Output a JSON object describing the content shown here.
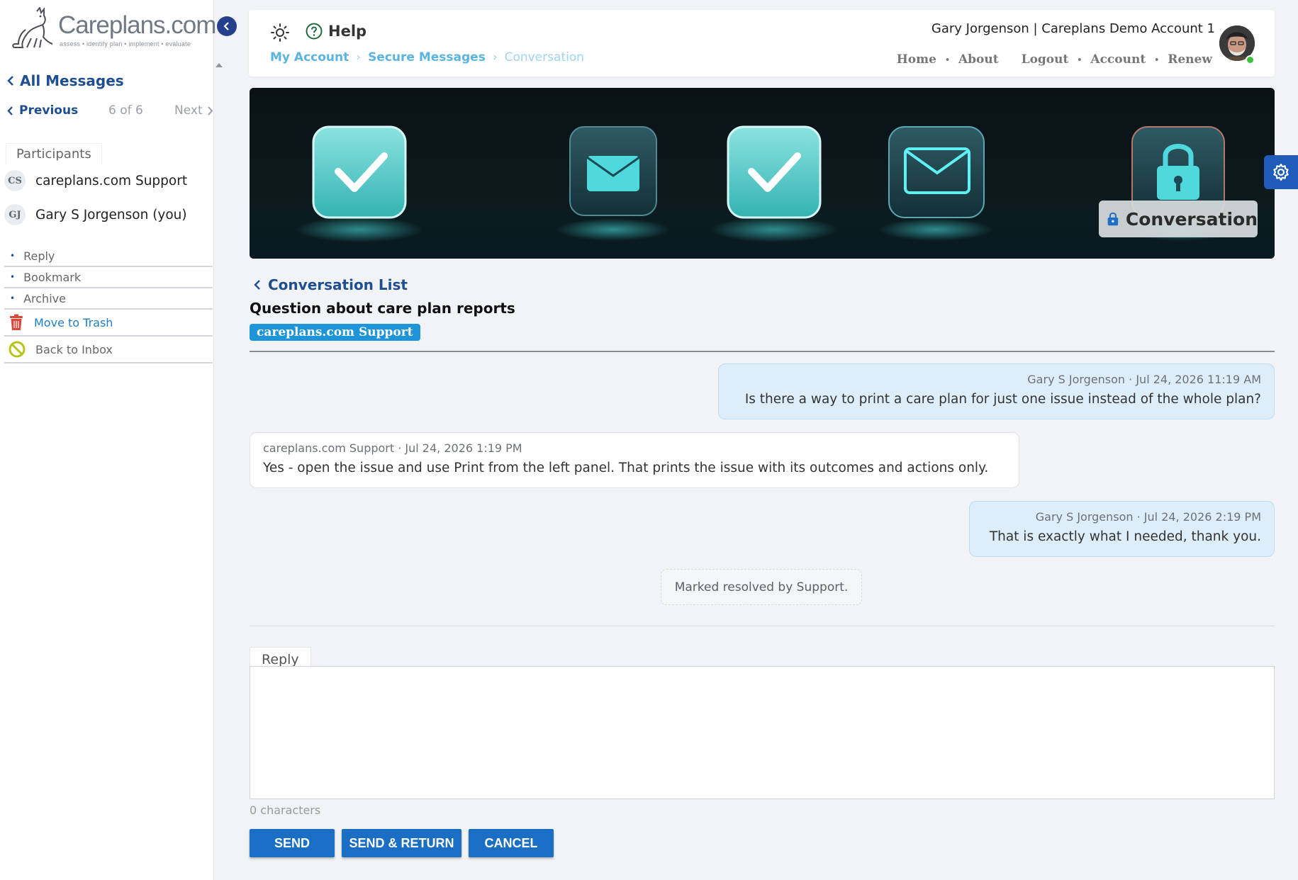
{
  "brand": {
    "name": "Careplans.com",
    "tagline": "assess • identify   plan • implement • evaluate"
  },
  "sidebar": {
    "all_messages": "All Messages",
    "pager": {
      "previous": "Previous",
      "count": "6 of 6",
      "next": "Next"
    },
    "participants_label": "Participants",
    "participants": [
      {
        "initials": "CS",
        "name": "careplans.com Support"
      },
      {
        "initials": "GJ",
        "name": "Gary S Jorgenson (you)"
      }
    ],
    "actions": {
      "reply": "Reply",
      "bookmark": "Bookmark",
      "archive": "Archive",
      "trash": "Move to Trash",
      "inbox": "Back to Inbox"
    }
  },
  "header": {
    "help": "Help",
    "breadcrumb": {
      "my_account": "My Account",
      "secure_messages": "Secure Messages",
      "current": "Conversation"
    },
    "user_line": "Gary Jorgenson | Careplans Demo Account 1",
    "nav": {
      "home": "Home",
      "about": "About",
      "logout": "Logout",
      "account": "Account",
      "renew": "Renew"
    }
  },
  "banner": {
    "badge": "Conversation"
  },
  "conversation": {
    "back_link": "Conversation List",
    "subject": "Question about care plan reports",
    "tag": "careplans.com Support",
    "messages": [
      {
        "meta": "Gary S Jorgenson · Jul 24, 2026 11:19 AM",
        "text": "Is there a way to print a care plan for just one issue instead of the whole plan?"
      },
      {
        "meta": "careplans.com Support · Jul 24, 2026 1:19 PM",
        "text": "Yes - open the issue and use Print from the left panel. That prints the issue with its outcomes and actions only."
      },
      {
        "meta": "Gary S Jorgenson · Jul 24, 2026 2:19 PM",
        "text": "That is exactly what I needed, thank you."
      }
    ],
    "system_note": "Marked resolved by Support."
  },
  "reply": {
    "label": "Reply",
    "value": "",
    "char_count": "0 characters",
    "buttons": {
      "send": "SEND",
      "send_return": "SEND & RETURN",
      "cancel": "CANCEL"
    }
  },
  "colors": {
    "navy_link": "#1f4f8f",
    "breadcrumb_link": "#5ab4df",
    "button_blue": "#1a6fc4",
    "tag_blue": "#1e95d9",
    "my_bubble": "#ddeefa",
    "online": "#3cc13b"
  },
  "icons": {
    "theme": "sun-icon",
    "help": "question-circle-icon",
    "trash": "trash-icon",
    "inbox": "no-entry-icon",
    "settings": "gear-icon",
    "banner": "padlock-icon"
  }
}
